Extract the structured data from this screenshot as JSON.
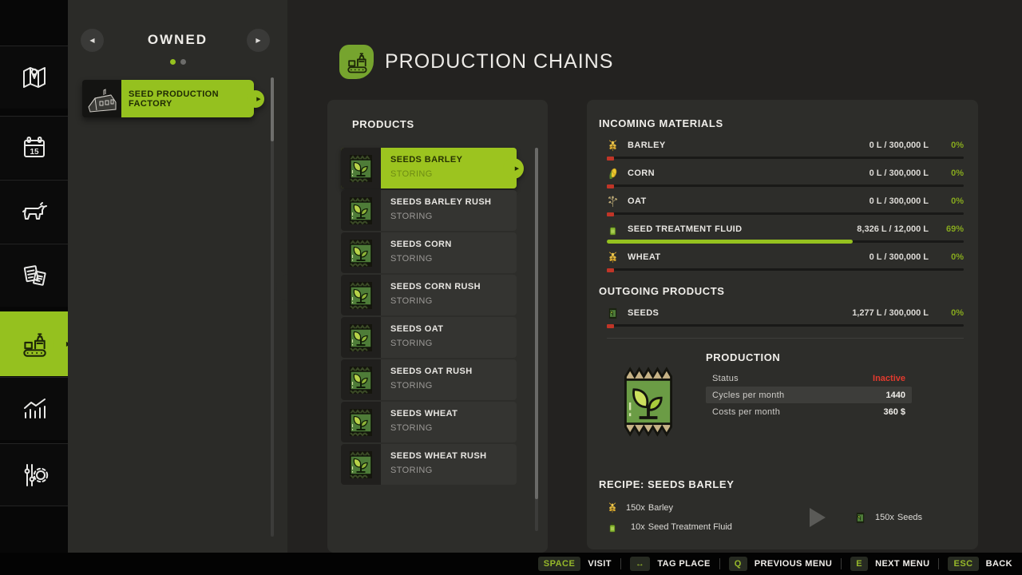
{
  "colors": {
    "accent": "#95c11f",
    "status_red": "#e23a2e",
    "percent_green": "#86a81e"
  },
  "sidebar": {
    "items": [
      {
        "name": "map"
      },
      {
        "name": "calendar"
      },
      {
        "name": "animals"
      },
      {
        "name": "finances"
      },
      {
        "name": "production-chains",
        "active": true
      },
      {
        "name": "statistics"
      },
      {
        "name": "settings"
      }
    ]
  },
  "owned": {
    "title": "OWNED",
    "item_label": "SEED PRODUCTION FACTORY",
    "pagination": {
      "dots": 2,
      "active_index": 0
    }
  },
  "header": {
    "title": "PRODUCTION CHAINS"
  },
  "products": {
    "title": "PRODUCTS",
    "items": [
      {
        "name": "SEEDS BARLEY",
        "status": "STORING",
        "selected": true
      },
      {
        "name": "SEEDS BARLEY RUSH",
        "status": "STORING"
      },
      {
        "name": "SEEDS CORN",
        "status": "STORING"
      },
      {
        "name": "SEEDS CORN RUSH",
        "status": "STORING"
      },
      {
        "name": "SEEDS OAT",
        "status": "STORING"
      },
      {
        "name": "SEEDS OAT RUSH",
        "status": "STORING"
      },
      {
        "name": "SEEDS WHEAT",
        "status": "STORING"
      },
      {
        "name": "SEEDS WHEAT RUSH",
        "status": "STORING"
      }
    ]
  },
  "incoming": {
    "title": "INCOMING MATERIALS",
    "rows": [
      {
        "name": "BARLEY",
        "icon": "barley-icon",
        "value": "0 L / 300,000 L",
        "percent": "0%",
        "fill": 0
      },
      {
        "name": "CORN",
        "icon": "corn-icon",
        "value": "0 L / 300,000 L",
        "percent": "0%",
        "fill": 0
      },
      {
        "name": "OAT",
        "icon": "oat-icon",
        "value": "0 L / 300,000 L",
        "percent": "0%",
        "fill": 0
      },
      {
        "name": "SEED TREATMENT FLUID",
        "icon": "fluid-icon",
        "value": "8,326 L / 12,000 L",
        "percent": "69%",
        "fill": 69
      },
      {
        "name": "WHEAT",
        "icon": "wheat-icon",
        "value": "0 L / 300,000 L",
        "percent": "0%",
        "fill": 0
      }
    ]
  },
  "outgoing": {
    "title": "OUTGOING PRODUCTS",
    "rows": [
      {
        "name": "SEEDS",
        "icon": "seeds-icon",
        "value": "1,277 L / 300,000 L",
        "percent": "0%",
        "fill": 0
      }
    ]
  },
  "production": {
    "title": "PRODUCTION",
    "rows": [
      {
        "label": "Status",
        "value": "Inactive"
      },
      {
        "label": "Cycles per month",
        "value": "1440"
      },
      {
        "label": "Costs per month",
        "value": "360 $"
      }
    ]
  },
  "recipe": {
    "title": "RECIPE: SEEDS BARLEY",
    "inputs": [
      {
        "qty": "150x",
        "name": "Barley",
        "icon": "barley-icon"
      },
      {
        "qty": "10x",
        "name": "Seed Treatment Fluid",
        "icon": "fluid-icon"
      }
    ],
    "output": {
      "qty": "150x",
      "name": "Seeds",
      "icon": "seeds-icon"
    }
  },
  "hotkeys": [
    {
      "key": "SPACE",
      "label": "VISIT"
    },
    {
      "key": "↔",
      "label": "TAG PLACE"
    },
    {
      "key": "Q",
      "label": "PREVIOUS MENU"
    },
    {
      "key": "E",
      "label": "NEXT MENU"
    },
    {
      "key": "ESC",
      "label": "BACK"
    }
  ]
}
